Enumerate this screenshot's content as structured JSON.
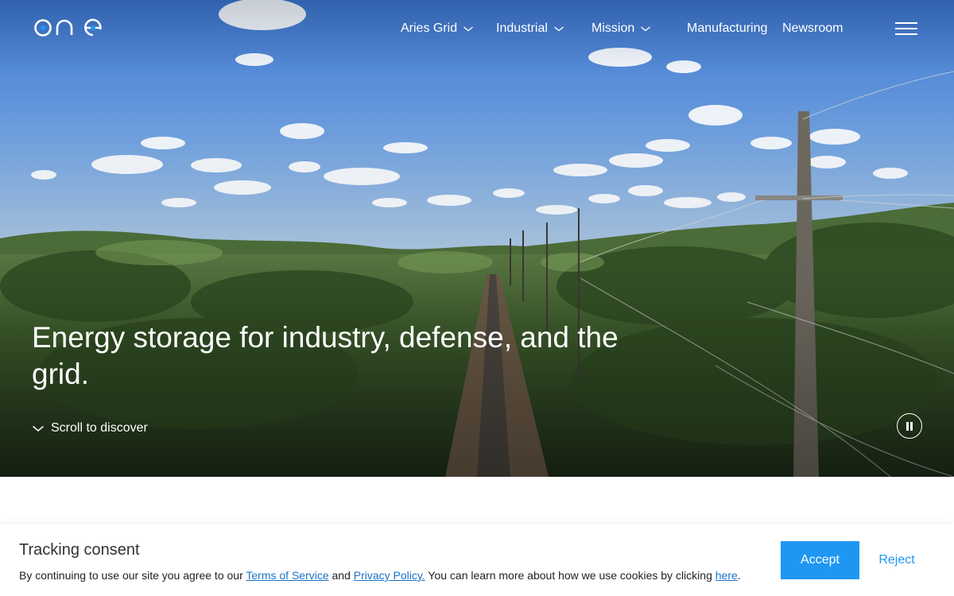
{
  "brand": {
    "logo_text": "one",
    "accent_color": "#1f97f2"
  },
  "nav": {
    "items": [
      {
        "label": "Aries Grid",
        "has_dropdown": true
      },
      {
        "label": "Industrial",
        "has_dropdown": true
      },
      {
        "label": "Mission",
        "has_dropdown": true
      },
      {
        "label": "Manufacturing",
        "has_dropdown": false
      },
      {
        "label": "Newsroom",
        "has_dropdown": false
      }
    ],
    "menu_icon": "hamburger-icon"
  },
  "hero": {
    "title": "Energy storage for industry, defense, and the grid.",
    "scroll_label": "Scroll to discover",
    "video_control_icon": "pause-icon"
  },
  "consent": {
    "title": "Tracking consent",
    "text_1": "By continuing to use our site you agree to our ",
    "terms_link": "Terms of Service",
    "text_2": " and ",
    "privacy_link": "Privacy Policy.",
    "text_3": " You can learn more about how we use cookies by clicking ",
    "here_link": "here",
    "text_4": ".",
    "accept_label": "Accept",
    "reject_label": "Reject"
  }
}
